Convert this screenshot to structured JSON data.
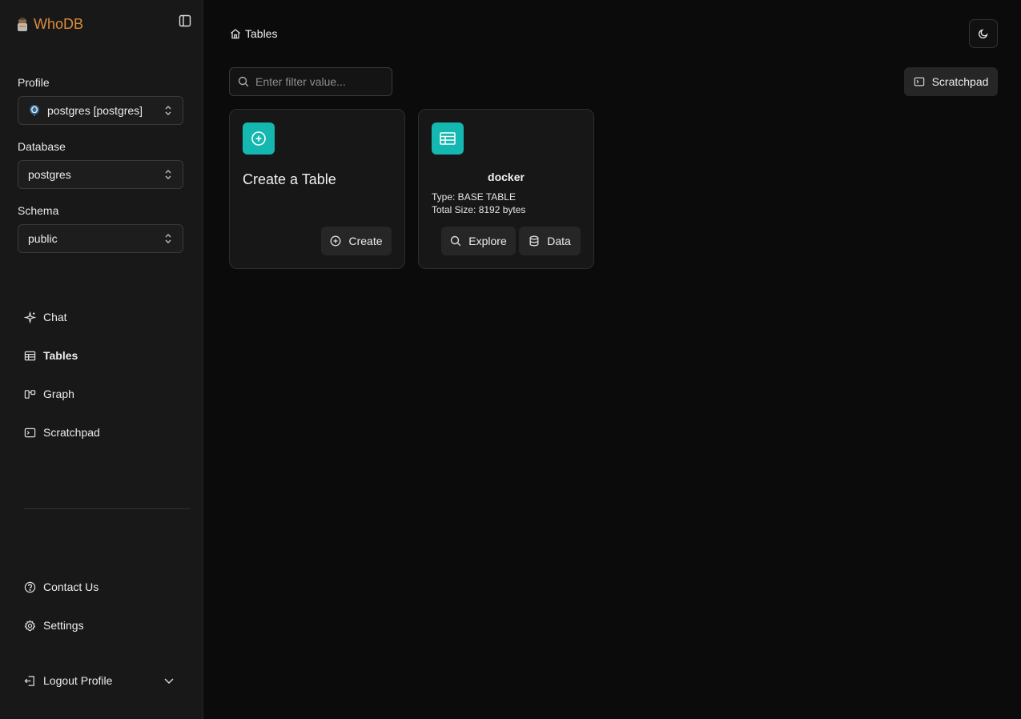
{
  "app": {
    "name": "WhoDB"
  },
  "sidebar": {
    "profile_label": "Profile",
    "profile_value": "postgres [postgres]",
    "database_label": "Database",
    "database_value": "postgres",
    "schema_label": "Schema",
    "schema_value": "public",
    "nav": [
      {
        "label": "Chat",
        "icon": "sparkles-icon",
        "active": false
      },
      {
        "label": "Tables",
        "icon": "table-icon",
        "active": true
      },
      {
        "label": "Graph",
        "icon": "graph-icon",
        "active": false
      },
      {
        "label": "Scratchpad",
        "icon": "terminal-icon",
        "active": false
      }
    ],
    "footer": [
      {
        "label": "Contact Us",
        "icon": "help-circle-icon"
      },
      {
        "label": "Settings",
        "icon": "gear-icon"
      }
    ],
    "logout_label": "Logout Profile"
  },
  "header": {
    "breadcrumb": "Tables"
  },
  "toolbar": {
    "search_placeholder": "Enter filter value...",
    "scratchpad_label": "Scratchpad"
  },
  "cards": {
    "create": {
      "title": "Create a Table",
      "button": "Create"
    },
    "table": {
      "name": "docker",
      "type": "Type: BASE TABLE",
      "size": "Total Size: 8192 bytes",
      "explore_label": "Explore",
      "data_label": "Data"
    }
  },
  "colors": {
    "accent": "#14b8b0",
    "brand": "#d98d3c",
    "background": "#0b0b0b",
    "sidebar": "#181818"
  }
}
